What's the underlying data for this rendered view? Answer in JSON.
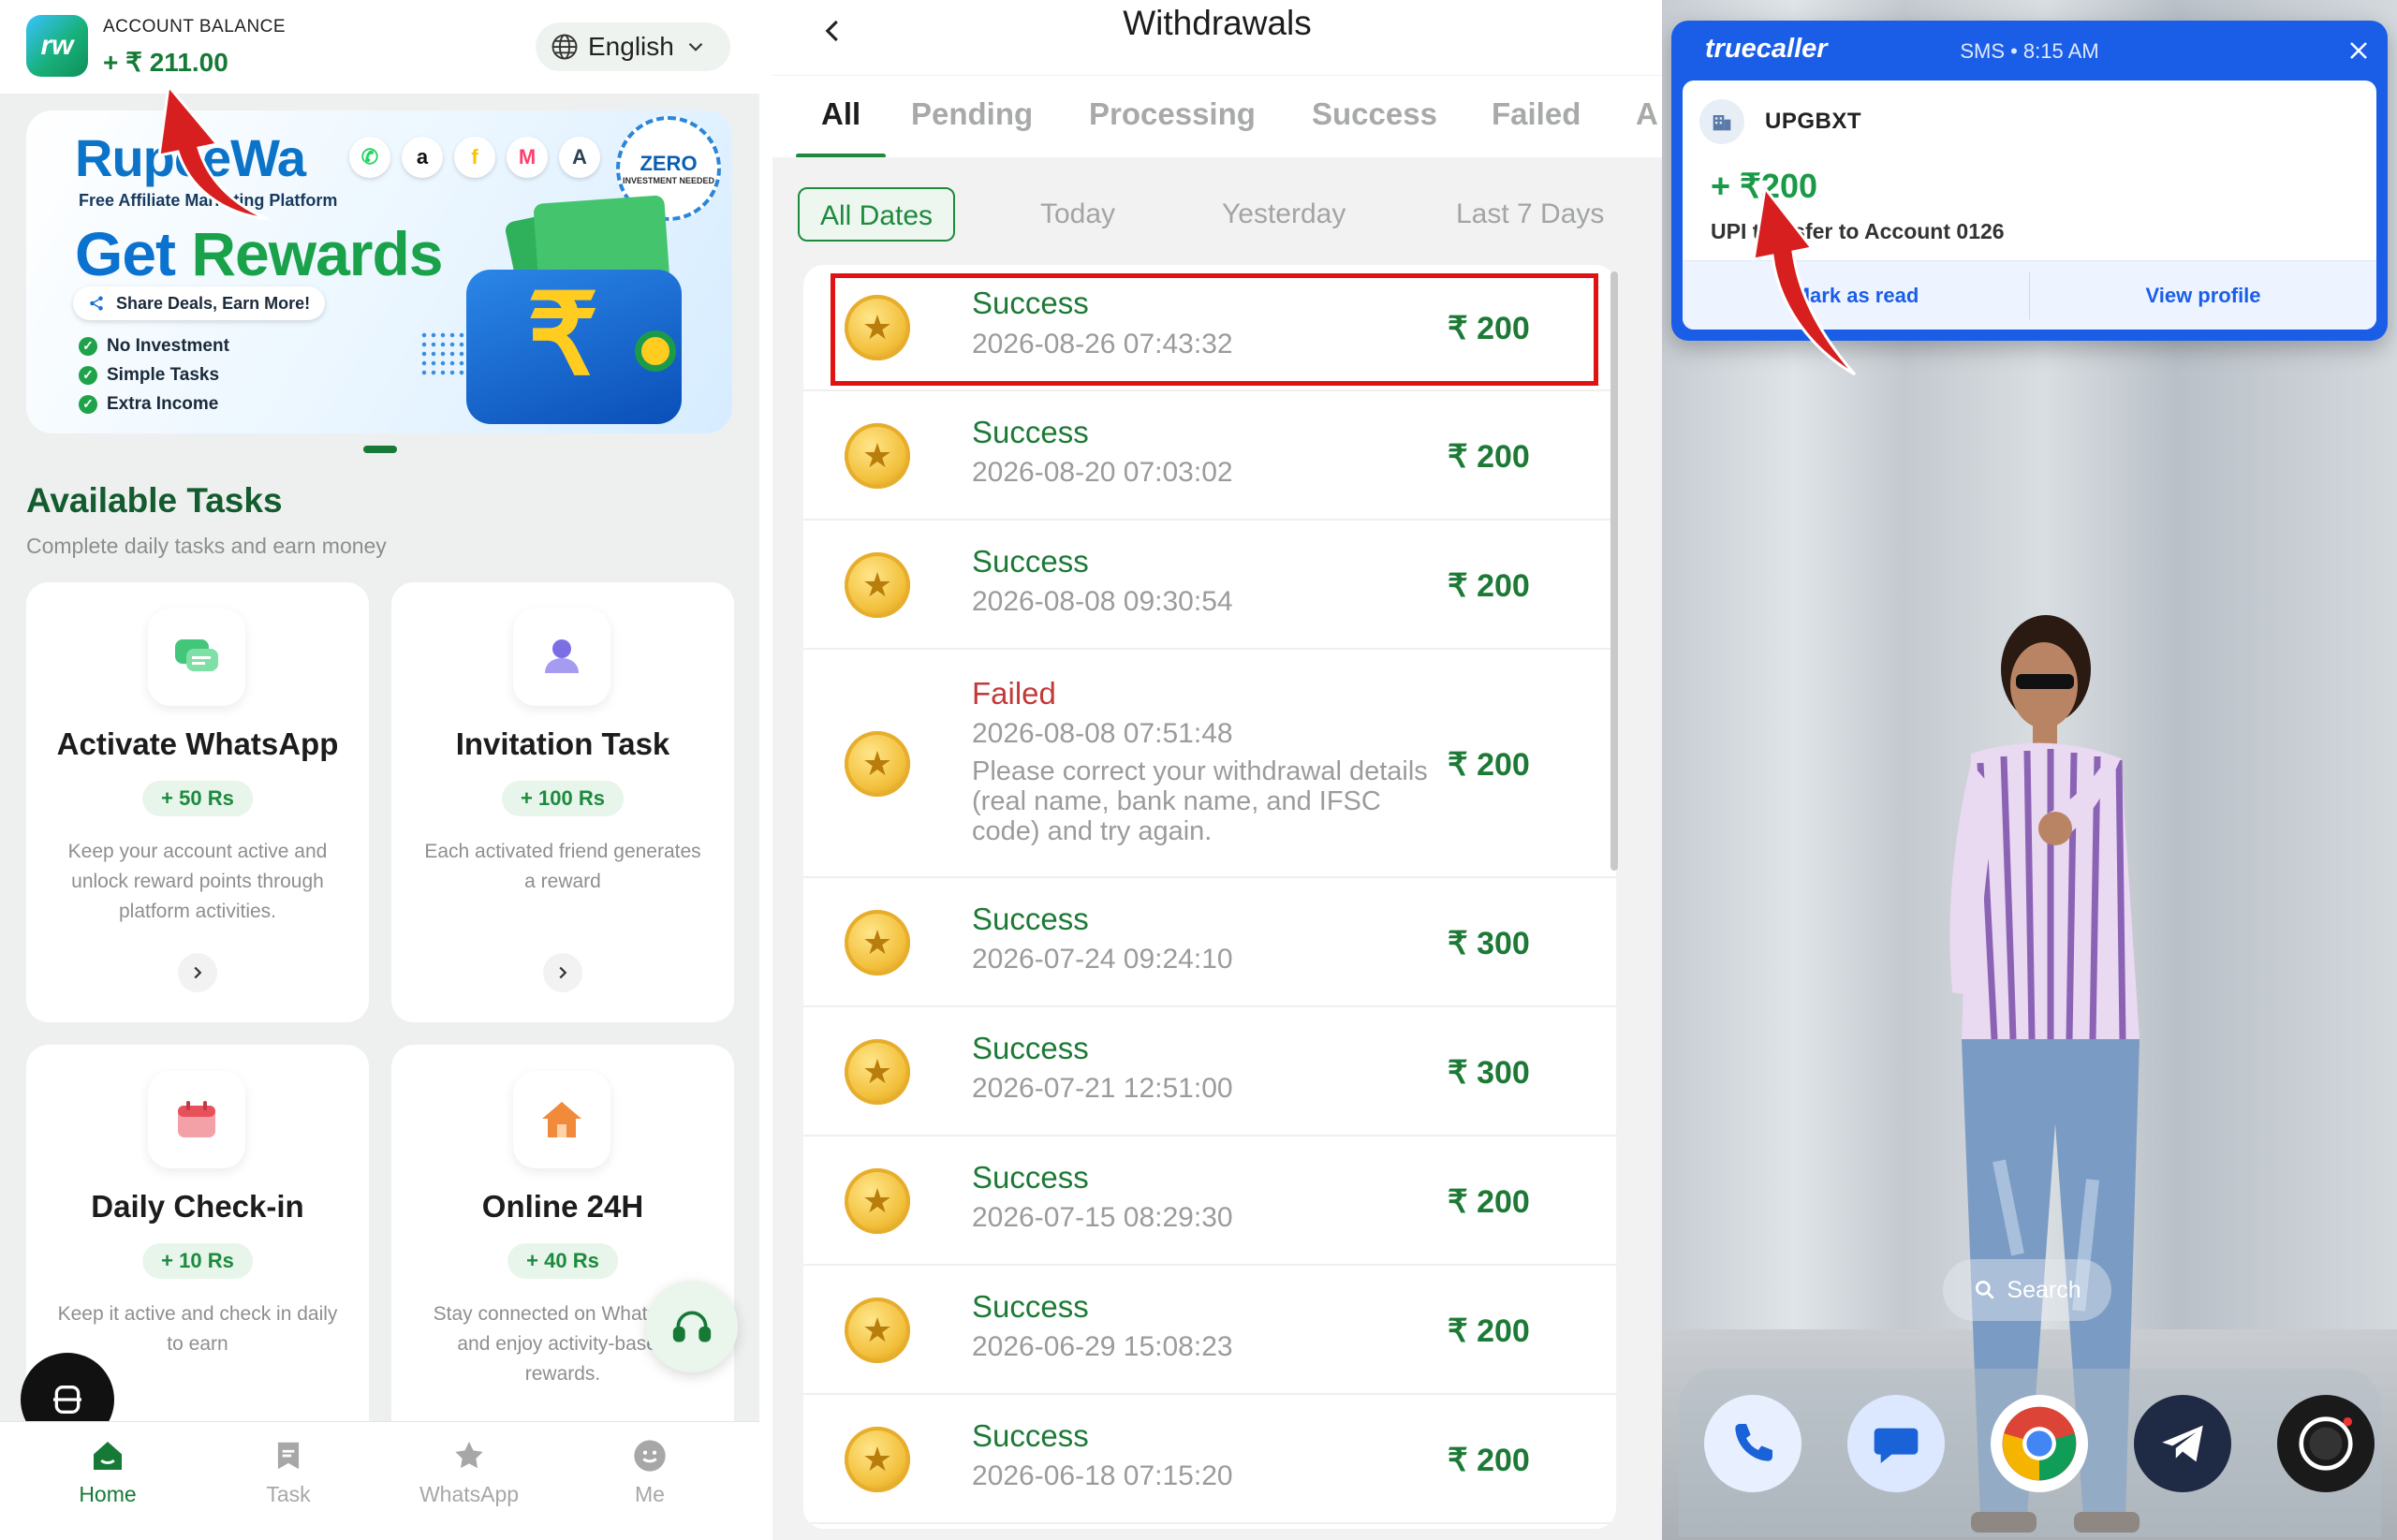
{
  "home": {
    "balance_label": "ACCOUNT BALANCE",
    "balance_value": "+ ₹ 211.00",
    "language": "English",
    "banner": {
      "brand": "RupeeWa",
      "subtitle": "Free Affiliate Marketing Platform",
      "headline_1": "Get",
      "headline_2": "Rewards",
      "pill": "Share Deals, Earn More!",
      "points": [
        "No Investment",
        "Simple Tasks",
        "Extra Income"
      ],
      "zero_1": "ZERO",
      "zero_2": "INVESTMENT NEEDED"
    },
    "section_title": "Available Tasks",
    "section_subtitle": "Complete daily tasks and earn money",
    "tasks": [
      {
        "title": "Activate WhatsApp",
        "reward": "+ 50 Rs",
        "desc": "Keep your account active and unlock reward points through platform activities.",
        "icon": "chat-bubbles-icon"
      },
      {
        "title": "Invitation Task",
        "reward": "+ 100 Rs",
        "desc": "Each activated friend generates a reward",
        "icon": "user-icon"
      },
      {
        "title": "Daily Check-in",
        "reward": "+ 10 Rs",
        "desc": "Keep it active and check in daily to earn",
        "icon": "calendar-icon"
      },
      {
        "title": "Online 24H",
        "reward": "+ 40 Rs",
        "desc": "Stay connected on WhatsApp and enjoy activity-based rewards.",
        "icon": "house-icon"
      }
    ],
    "tabbar": [
      {
        "label": "Home",
        "icon": "home-icon"
      },
      {
        "label": "Task",
        "icon": "task-icon"
      },
      {
        "label": "WhatsApp",
        "icon": "star-icon"
      },
      {
        "label": "Me",
        "icon": "smiley-icon"
      }
    ],
    "accent": "#167a36"
  },
  "withdrawals": {
    "title": "Withdrawals",
    "tabs": [
      "All",
      "Pending",
      "Processing",
      "Success",
      "Failed",
      "A"
    ],
    "date_filters": [
      "All Dates",
      "Today",
      "Yesterday",
      "Last 7 Days"
    ],
    "rows": [
      {
        "status": "Success",
        "date": "2026-08-26 07:43:32",
        "amount": "₹ 200"
      },
      {
        "status": "Success",
        "date": "2026-08-20 07:03:02",
        "amount": "₹ 200"
      },
      {
        "status": "Success",
        "date": "2026-08-08 09:30:54",
        "amount": "₹ 200"
      },
      {
        "status": "Failed",
        "date": "2026-08-08 07:51:48",
        "amount": "₹ 200",
        "note": "Please correct your withdrawal details (real name, bank name, and IFSC code) and try again."
      },
      {
        "status": "Success",
        "date": "2026-07-24 09:24:10",
        "amount": "₹ 300"
      },
      {
        "status": "Success",
        "date": "2026-07-21 12:51:00",
        "amount": "₹ 300"
      },
      {
        "status": "Success",
        "date": "2026-07-15 08:29:30",
        "amount": "₹ 200"
      },
      {
        "status": "Success",
        "date": "2026-06-29 15:08:23",
        "amount": "₹ 200"
      },
      {
        "status": "Success",
        "date": "2026-06-18 07:15:20",
        "amount": "₹ 200"
      }
    ],
    "success_color": "#1d7a36",
    "failed_color": "#c23a3a",
    "highlight_color": "#e01212"
  },
  "notification": {
    "app": "truecaller",
    "meta": "SMS • 8:15 AM",
    "sender": "UPGBXT",
    "amount": "+ ₹200",
    "message": "UPI transfer to Account 0126",
    "action_read": "Mark as read",
    "action_profile": "View profile",
    "brand_color": "#1a5ee8"
  },
  "launcher": {
    "search_label": "Search",
    "dock": [
      "phone-icon",
      "messages-icon",
      "chrome-icon",
      "telegram-icon",
      "camera-icon"
    ]
  }
}
